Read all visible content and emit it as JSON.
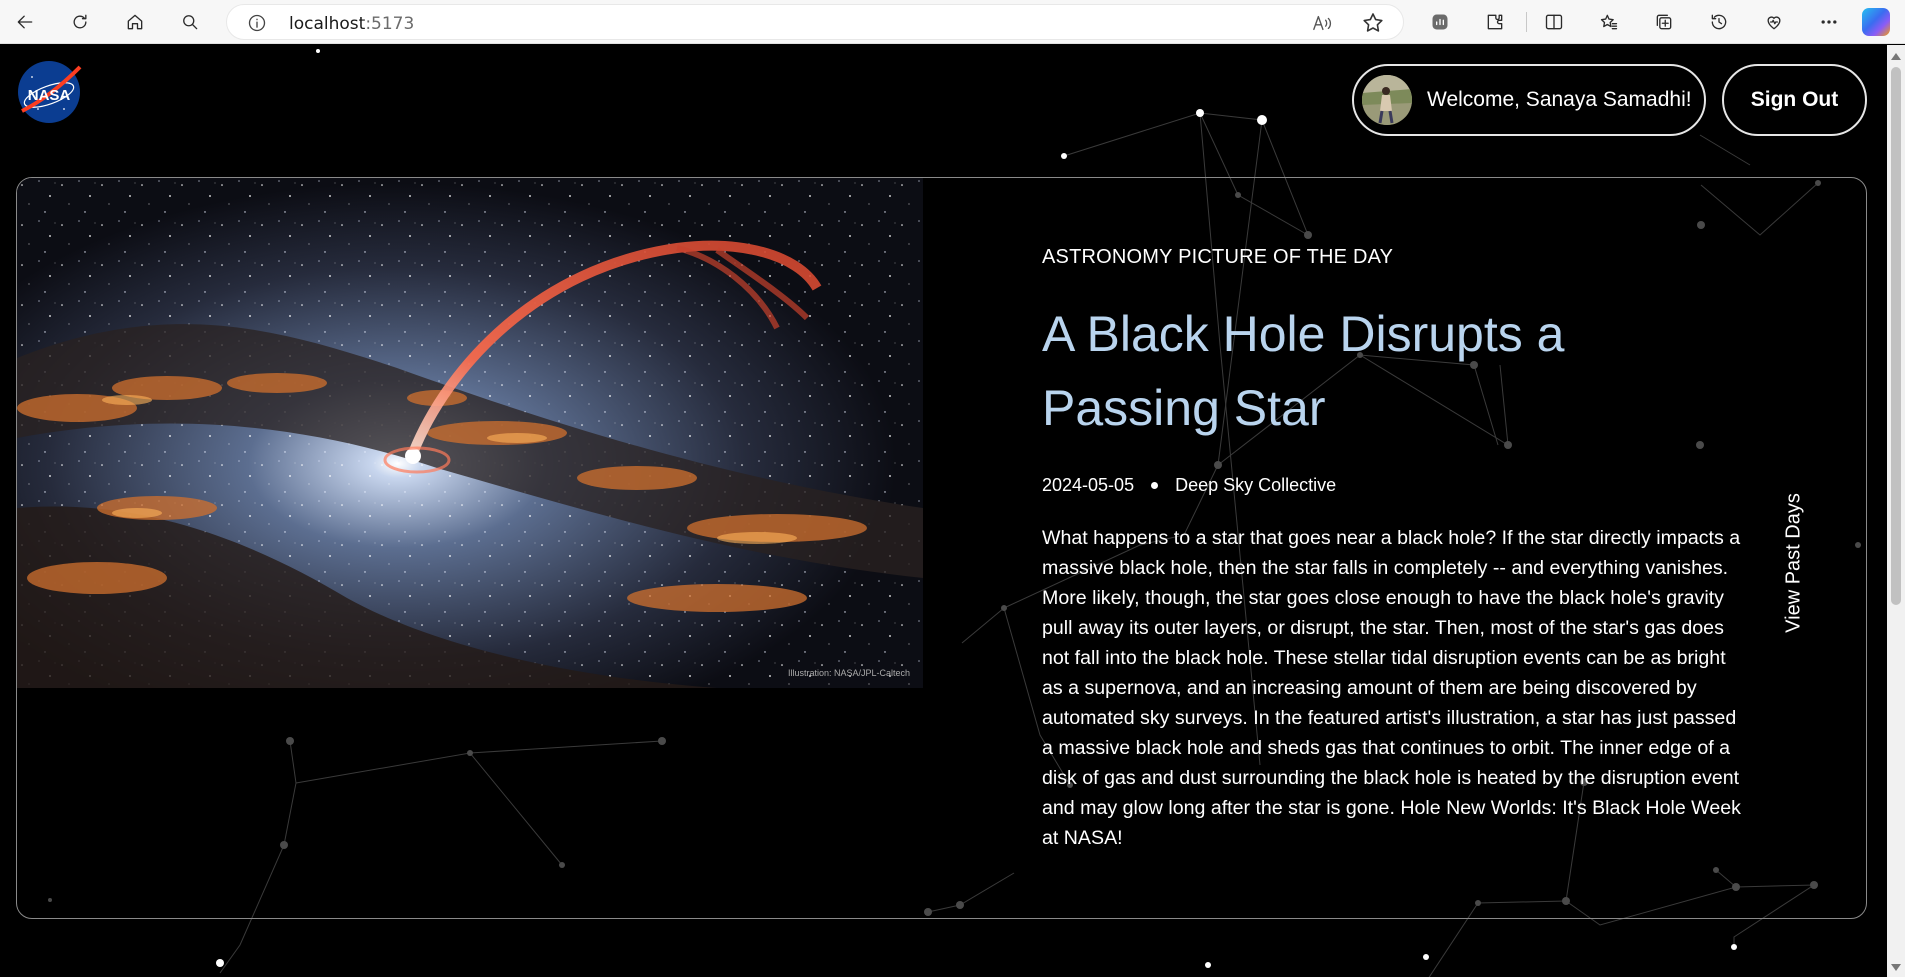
{
  "browser": {
    "url_host": "localhost",
    "url_port": ":5173",
    "read_aloud_icon": "read-aloud-icon"
  },
  "header": {
    "logo_text": "NASA",
    "welcome_text": "Welcome, Sanaya Samadhi!",
    "signout_label": "Sign Out"
  },
  "apod": {
    "eyebrow": "ASTRONOMY PICTURE OF THE DAY",
    "title": "A Black Hole Disrupts a Passing Star",
    "date": "2024-05-05",
    "copyright": "Deep Sky Collective",
    "image_credit": "Illustration: NASA/JPL-Caltech",
    "explanation": "What happens to a star that goes near a black hole? If the star directly impacts a massive black hole, then the star falls in completely -- and everything vanishes. More likely, though, the star goes close enough to have the black hole's gravity pull away its outer layers, or disrupt, the star. Then, most of the star's gas does not fall into the black hole. These stellar tidal disruption events can be as bright as a supernova, and an increasing amount of them are being discovered by automated sky surveys. In the featured artist's illustration, a star has just passed a massive black hole and sheds gas that continues to orbit. The inner edge of a disk of gas and dust surrounding the black hole is heated by the disruption event and may glow long after the star is gone. Hole New Worlds: It's Black Hole Week at NASA!",
    "past_days_label": "View Past Days"
  },
  "colors": {
    "background": "#000000",
    "title": "#b9d4ee",
    "border": "#8a8a8a"
  }
}
